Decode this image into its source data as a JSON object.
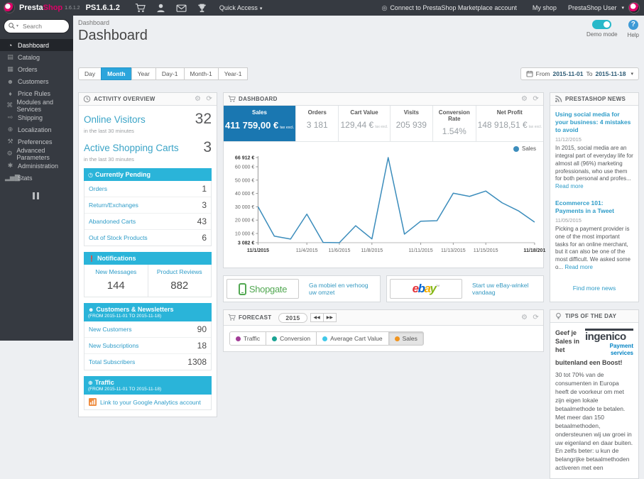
{
  "topbar": {
    "brand_presta": "Presta",
    "brand_shop": "Shop",
    "brand_version": "1.6.1.2",
    "ps_version": "PS1.6.1.2",
    "quick_access": "Quick Access",
    "marketplace_link": "Connect to PrestaShop Marketplace account",
    "my_shop": "My shop",
    "user_name": "PrestaShop User"
  },
  "sidebar": {
    "search_placeholder": "Search",
    "items": [
      {
        "label": "Dashboard",
        "icon": "gauge-icon",
        "active": true
      },
      {
        "label": "Catalog",
        "icon": "book-icon"
      },
      {
        "label": "Orders",
        "icon": "orders-icon"
      },
      {
        "label": "Customers",
        "icon": "customers-icon"
      },
      {
        "label": "Price Rules",
        "icon": "tag-icon"
      },
      {
        "label": "Modules and Services",
        "icon": "modules-icon"
      },
      {
        "label": "Shipping",
        "icon": "truck-icon"
      },
      {
        "label": "Localization",
        "icon": "globe-icon"
      },
      {
        "label": "Preferences",
        "icon": "wrench-icon"
      },
      {
        "label": "Advanced Parameters",
        "icon": "cogs-icon"
      },
      {
        "label": "Administration",
        "icon": "gear-icon"
      },
      {
        "label": "Stats",
        "icon": "bar-chart-icon"
      }
    ]
  },
  "page_header": {
    "breadcrumb": "Dashboard",
    "title": "Dashboard",
    "demo_mode_label": "Demo mode",
    "help_label": "Help"
  },
  "filters": {
    "buttons": [
      "Day",
      "Month",
      "Year",
      "Day-1",
      "Month-1",
      "Year-1"
    ],
    "active": "Month",
    "from_label": "From",
    "date_from": "2015-11-01",
    "to_label": "To",
    "date_to": "2015-11-18"
  },
  "activity": {
    "title": "ACTIVITY OVERVIEW",
    "online_visitors": {
      "label": "Online Visitors",
      "value": "32",
      "sub": "in the last 30 minutes"
    },
    "shopping_carts": {
      "label": "Active Shopping Carts",
      "value": "3",
      "sub": "in the last 30 minutes"
    },
    "pending": {
      "title": "Currently Pending",
      "rows": [
        {
          "label": "Orders",
          "value": "1"
        },
        {
          "label": "Return/Exchanges",
          "value": "3"
        },
        {
          "label": "Abandoned Carts",
          "value": "43"
        },
        {
          "label": "Out of Stock Products",
          "value": "6"
        }
      ]
    },
    "notifications": {
      "title": "Notifications",
      "cols": [
        {
          "label": "New Messages",
          "value": "144"
        },
        {
          "label": "Product Reviews",
          "value": "882"
        }
      ]
    },
    "customers": {
      "title": "Customers & Newsletters",
      "subtitle": "(FROM 2015-11-01 TO 2015-11-18)",
      "rows": [
        {
          "label": "New Customers",
          "value": "90"
        },
        {
          "label": "New Subscriptions",
          "value": "18"
        },
        {
          "label": "Total Subscribers",
          "value": "1308"
        }
      ]
    },
    "traffic": {
      "title": "Traffic",
      "subtitle": "(FROM 2015-11-01 TO 2015-11-18)",
      "link": "Link to your Google Analytics account"
    }
  },
  "dashboard_panel": {
    "title": "DASHBOARD",
    "kpis": [
      {
        "label": "Sales",
        "value": "411 759,00 €",
        "suffix": "tax excl.",
        "active": true
      },
      {
        "label": "Orders",
        "value": "3 181"
      },
      {
        "label": "Cart Value",
        "value": "129,44 €",
        "suffix": "tax excl."
      },
      {
        "label": "Visits",
        "value": "205 939"
      },
      {
        "label": "Conversion Rate",
        "value": "1.54%"
      },
      {
        "label": "Net Profit",
        "value": "148 918,51 €",
        "suffix": "tax excl."
      }
    ],
    "legend": "Sales"
  },
  "chart_data": {
    "type": "line",
    "series": [
      {
        "name": "Sales",
        "x": [
          "11/1/2015",
          "11/2/2015",
          "11/3/2015",
          "11/4/2015",
          "11/5/2015",
          "11/6/2015",
          "11/7/2015",
          "11/8/2015",
          "11/9/2015",
          "11/10/2015",
          "11/11/2015",
          "11/12/2015",
          "11/13/2015",
          "11/14/2015",
          "11/15/2015",
          "11/16/2015",
          "11/17/2015",
          "11/18/2015"
        ],
        "values": [
          30000,
          8000,
          5800,
          24500,
          3300,
          3082,
          15800,
          5900,
          66912,
          9500,
          19200,
          19600,
          40200,
          37800,
          41800,
          33000,
          27000,
          18500
        ]
      }
    ],
    "ylim": [
      3082,
      66912
    ],
    "y_ticks": [
      {
        "label": "66 912 €",
        "value": 66912,
        "bold": true
      },
      {
        "label": "60 000 €",
        "value": 60000
      },
      {
        "label": "50 000 €",
        "value": 50000
      },
      {
        "label": "40 000 €",
        "value": 40000
      },
      {
        "label": "30 000 €",
        "value": 30000
      },
      {
        "label": "20 000 €",
        "value": 20000
      },
      {
        "label": "10 000 €",
        "value": 10000
      },
      {
        "label": "3 082 €",
        "value": 3082,
        "bold": true
      }
    ],
    "x_ticks": [
      {
        "label": "11/1/2015",
        "day": 0,
        "bold": true
      },
      {
        "label": "11/4/2015",
        "day": 3
      },
      {
        "label": "11/6/2015",
        "day": 5
      },
      {
        "label": "11/8/2015",
        "day": 7
      },
      {
        "label": "11/11/2015",
        "day": 10
      },
      {
        "label": "11/13/2015",
        "day": 12
      },
      {
        "label": "11/15/2015",
        "day": 14
      },
      {
        "label": "11/18/201",
        "day": 17,
        "bold": true
      }
    ],
    "legend": [
      "Sales"
    ],
    "legend_position": "top-right",
    "grid": false,
    "line_color": "#3c8dbc"
  },
  "news_panel": {
    "title": "PRESTASHOP NEWS",
    "items": [
      {
        "title": "Using social media for your business: 4 mistakes to avoid",
        "date": "11/12/2015",
        "body": "In 2015, social media are an integral part of everyday life for almost all (96%) marketing professionals, who use them for both personal and profes...",
        "read_more": "Read more"
      },
      {
        "title": "Ecommerce 101: Payments in a Tweet",
        "date": "11/05/2015",
        "body": "Picking a payment provider is one of the most important tasks for an online merchant, but it can also be one of the most difficult. We asked some o...",
        "read_more": "Read more"
      }
    ],
    "more_link": "Find more news"
  },
  "banners": {
    "shopgate": {
      "brand": "Shopgate",
      "link": "Ga mobiel en verhoog uw omzet"
    },
    "ebay": {
      "letters": [
        {
          "char": "e",
          "color": "#e53238"
        },
        {
          "char": "b",
          "color": "#0064d2"
        },
        {
          "char": "a",
          "color": "#f5af02"
        },
        {
          "char": "y",
          "color": "#86b817"
        }
      ],
      "tm": "™",
      "link": "Start uw eBay-winkel vandaag"
    }
  },
  "forecast_panel": {
    "title": "FORECAST",
    "year": "2015",
    "toggles": [
      {
        "label": "Traffic",
        "color": "#a23d97"
      },
      {
        "label": "Conversion",
        "color": "#1aa393"
      },
      {
        "label": "Average Cart Value",
        "color": "#41c8e8"
      },
      {
        "label": "Sales",
        "color": "#f0941f",
        "active": true
      }
    ]
  },
  "tips_panel": {
    "title": "TIPS OF THE DAY",
    "headline": "Geef je Sales in het buitenland een Boost!",
    "logo": {
      "text": "ingenico",
      "sub1": "Payment",
      "sub2": "services"
    },
    "body": "30 tot 70% van de consumenten in Europa heeft de voorkeur om met zijn eigen lokale betaalmethode te betalen. Met meer dan 150 betaalmethoden, ondersteunen wij uw groei in uw eigenland en daar buiten. En zelfs beter: u kun de belangrijke betaalmethoden activeren met een"
  },
  "colors": {
    "topbar": "#363a41",
    "section_header_blue": "#2ab4d9",
    "active_filter_blue": "#2ba5dc",
    "kpi_active_blue": "#1a77b1",
    "link_blue": "#2e9cc8",
    "chart_line": "#3c8dbc",
    "toggle_teal": "#28b8c9"
  }
}
